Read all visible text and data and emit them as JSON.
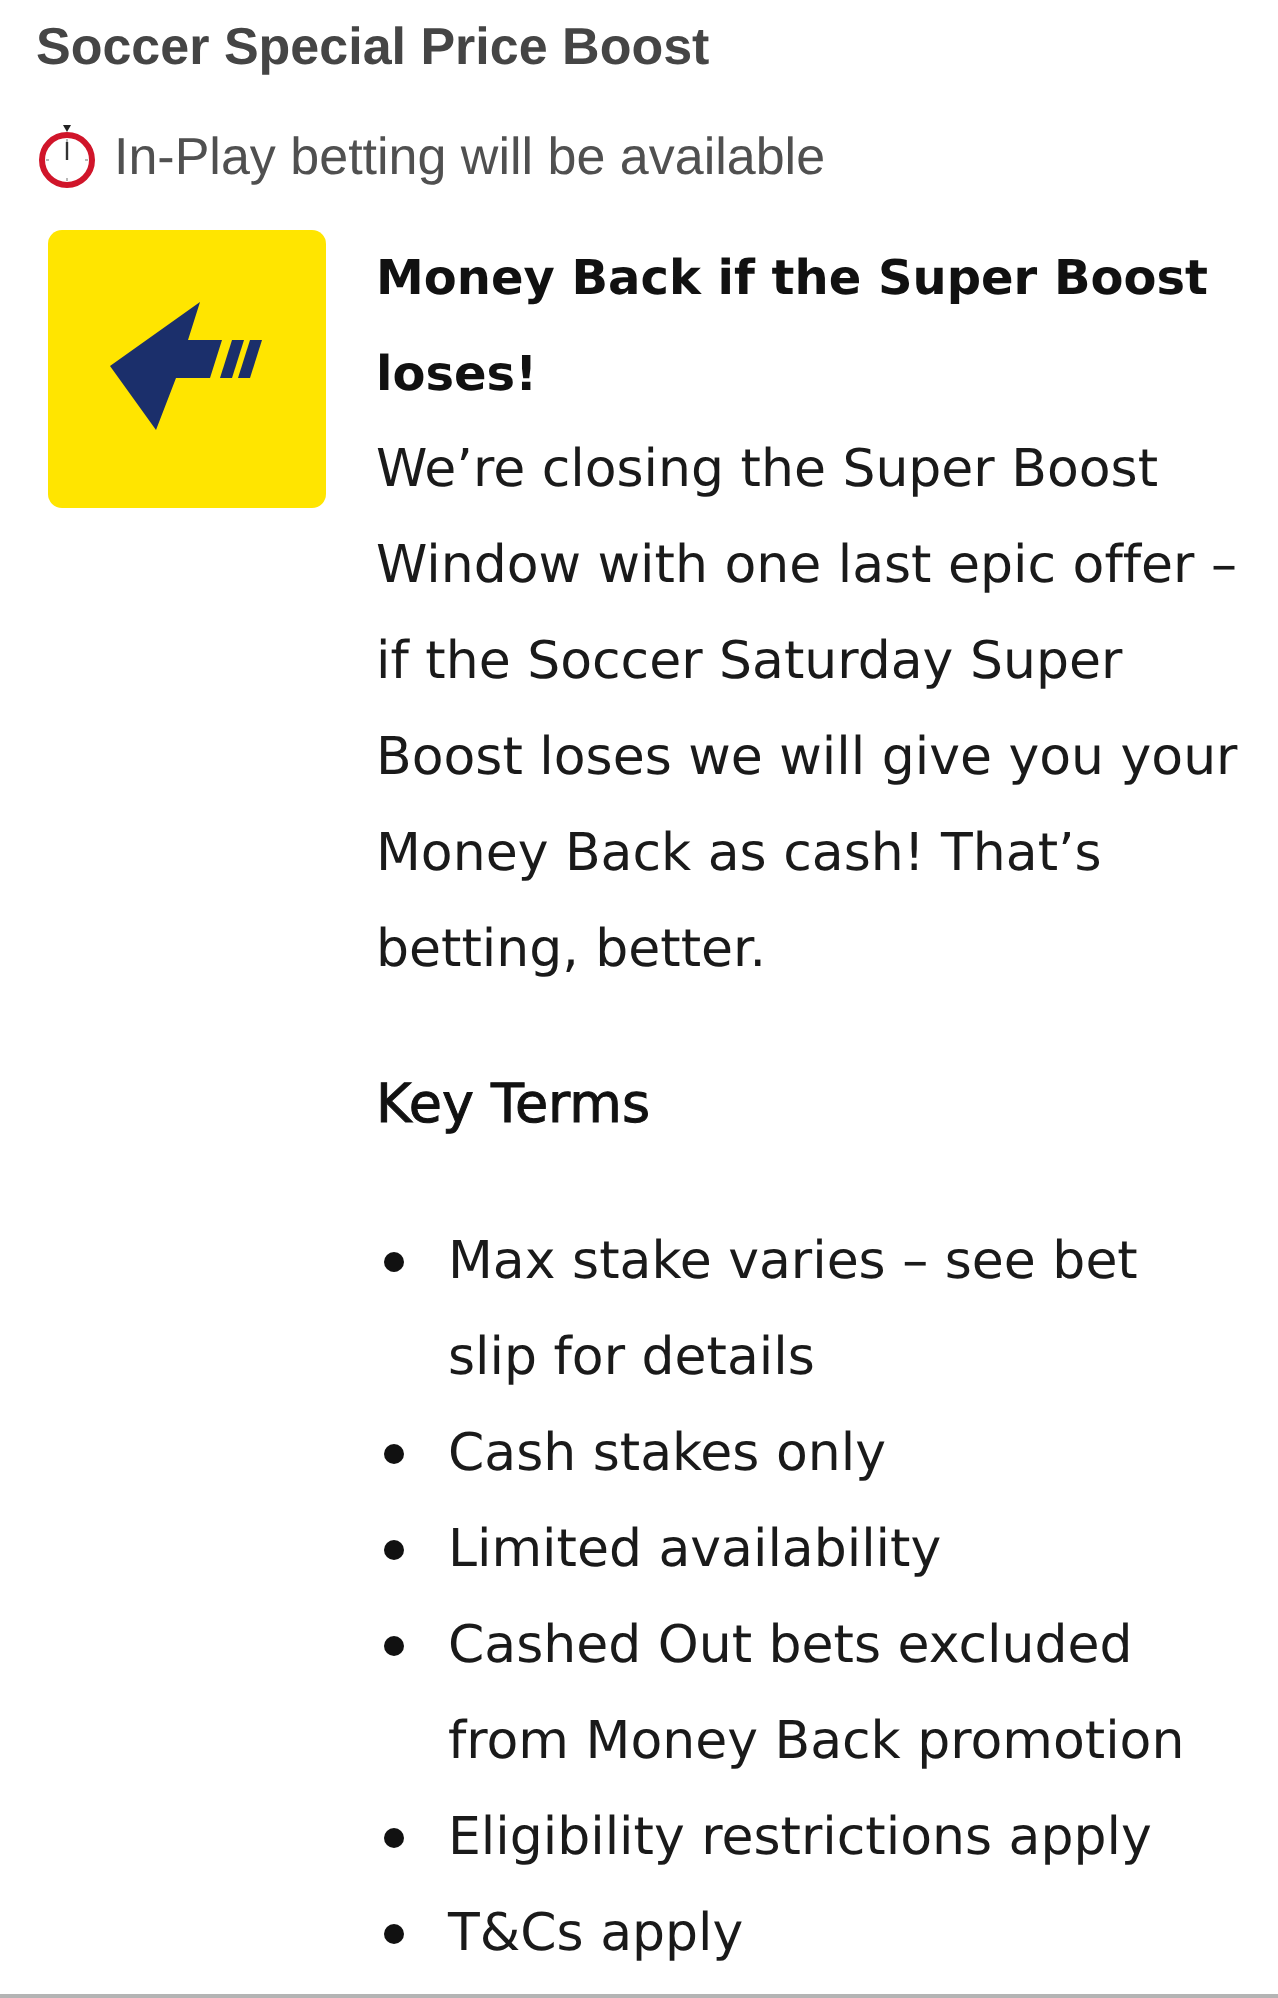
{
  "header": {
    "title": "Soccer Special Price Boost",
    "notice": "In-Play betting will be available"
  },
  "offer": {
    "headline": "Money Back if the Super Boost loses!",
    "body": "We’re closing the Super Boost Window with one last epic offer – if the Soccer Saturday Super Boost loses we will give you your Money Back as cash! That’s betting, better.",
    "key_terms": {
      "heading": "Key Terms",
      "items": [
        "Max stake varies – see bet slip for details",
        "Cash stakes only",
        "Limited availability",
        "Cashed Out bets excluded from Money Back promotion",
        "Eligibility restrictions apply",
        "T&Cs apply"
      ]
    }
  }
}
